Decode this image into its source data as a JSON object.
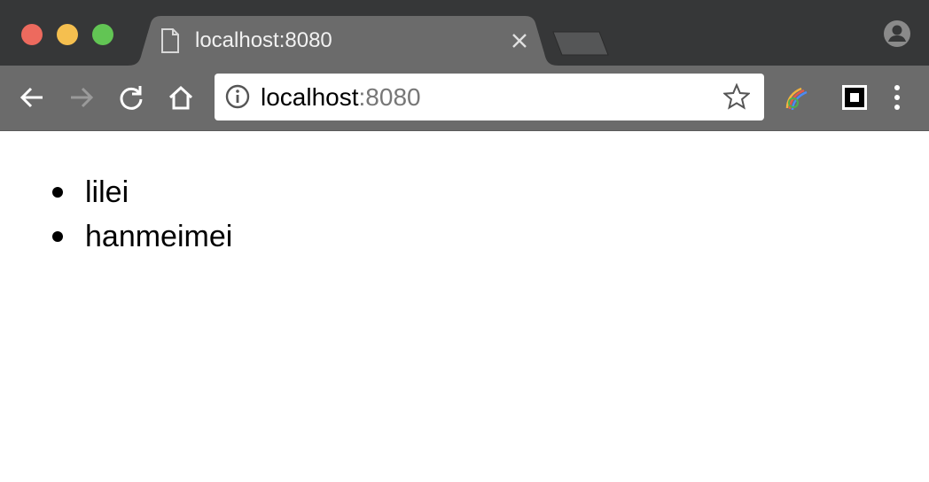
{
  "window": {
    "traffic_lights": {
      "close": "#ed6a5e",
      "minimize": "#f5bf4f",
      "zoom": "#62c554"
    }
  },
  "tab": {
    "title": "localhost:8080",
    "icon": "file-icon"
  },
  "toolbar": {
    "address": {
      "host": "localhost",
      "port": ":8080",
      "icon": "info-icon"
    }
  },
  "content": {
    "items": [
      "lilei",
      "hanmeimei"
    ]
  }
}
